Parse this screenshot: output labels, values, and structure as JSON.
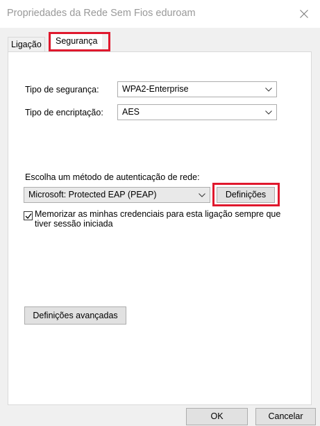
{
  "window": {
    "title": "Propriedades da Rede Sem Fios eduroam"
  },
  "tabs": [
    {
      "label": "Ligação"
    },
    {
      "label": "Segurança"
    }
  ],
  "security": {
    "security_type_label": "Tipo de segurança:",
    "security_type_value": "WPA2-Enterprise",
    "encryption_type_label": "Tipo de encriptação:",
    "encryption_type_value": "AES",
    "auth_method_label": "Escolha um método de autenticação de rede:",
    "auth_method_value": "Microsoft: Protected EAP (PEAP)",
    "settings_button": "Definições",
    "remember_credentials_label": "Memorizar as minhas credenciais para esta ligação sempre que tiver sessão iniciada",
    "remember_credentials_checked": true,
    "advanced_settings_button": "Definições avançadas"
  },
  "footer": {
    "ok_button": "OK",
    "cancel_button": "Cancelar"
  },
  "icons": {
    "close": "close-icon",
    "dropdown": "chevron-down-icon",
    "check": "checkmark-icon"
  },
  "colors": {
    "highlight": "#e0182d",
    "title_text": "#999999"
  }
}
